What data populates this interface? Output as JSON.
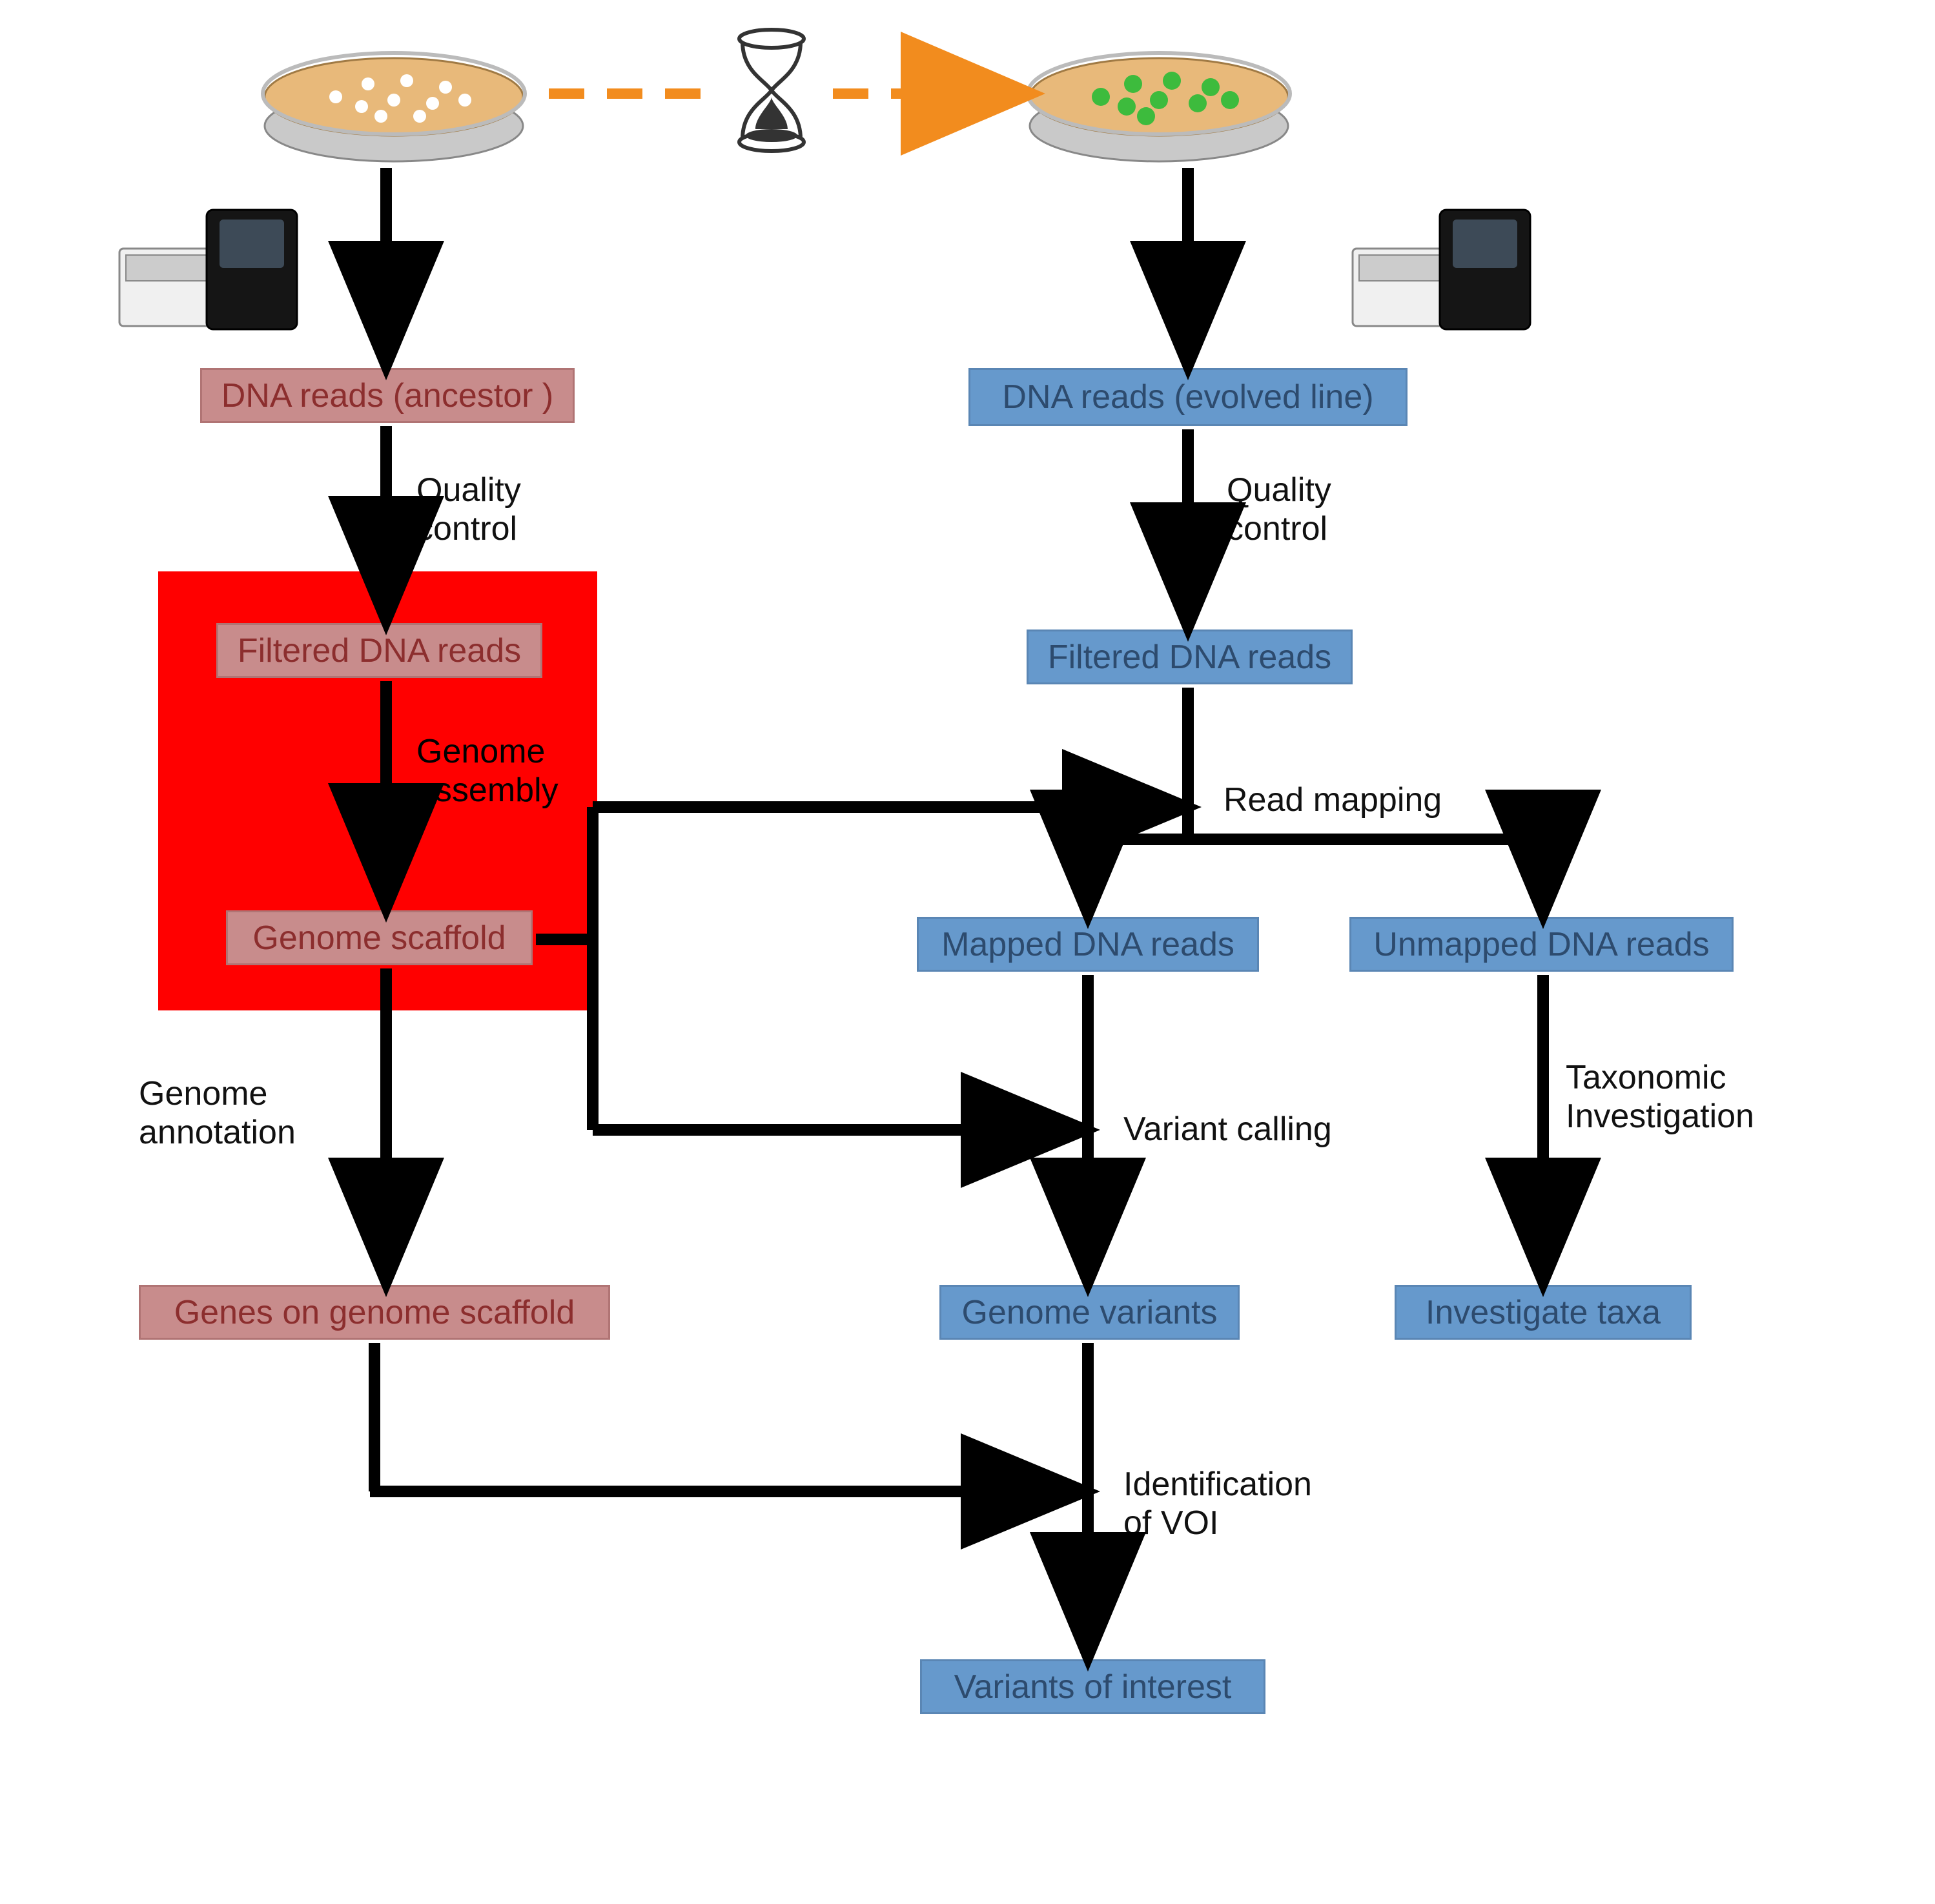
{
  "nodes": {
    "anc_reads": "DNA reads (ancestor )",
    "anc_filtered": "Filtered DNA reads",
    "anc_scaffold": "Genome scaffold",
    "anc_genes": "Genes on genome scaffold",
    "evo_reads": "DNA reads (evolved  line)",
    "evo_filtered": "Filtered DNA reads",
    "evo_mapped": "Mapped DNA reads",
    "evo_unmapped": "Unmapped DNA reads",
    "evo_variants": "Genome variants",
    "evo_taxa": "Investigate taxa",
    "evo_voi": "Variants of interest"
  },
  "labels": {
    "qc_left": "Quality\ncontrol",
    "qc_right": "Quality\ncontrol",
    "genome_assembly": "Genome\nassembly",
    "genome_annotation": "Genome\nannotation",
    "read_mapping": "Read mapping",
    "variant_calling": "Variant calling",
    "taxonomic": "Taxonomic\nInvestigation",
    "id_voi": "Identification\nof VOI"
  }
}
